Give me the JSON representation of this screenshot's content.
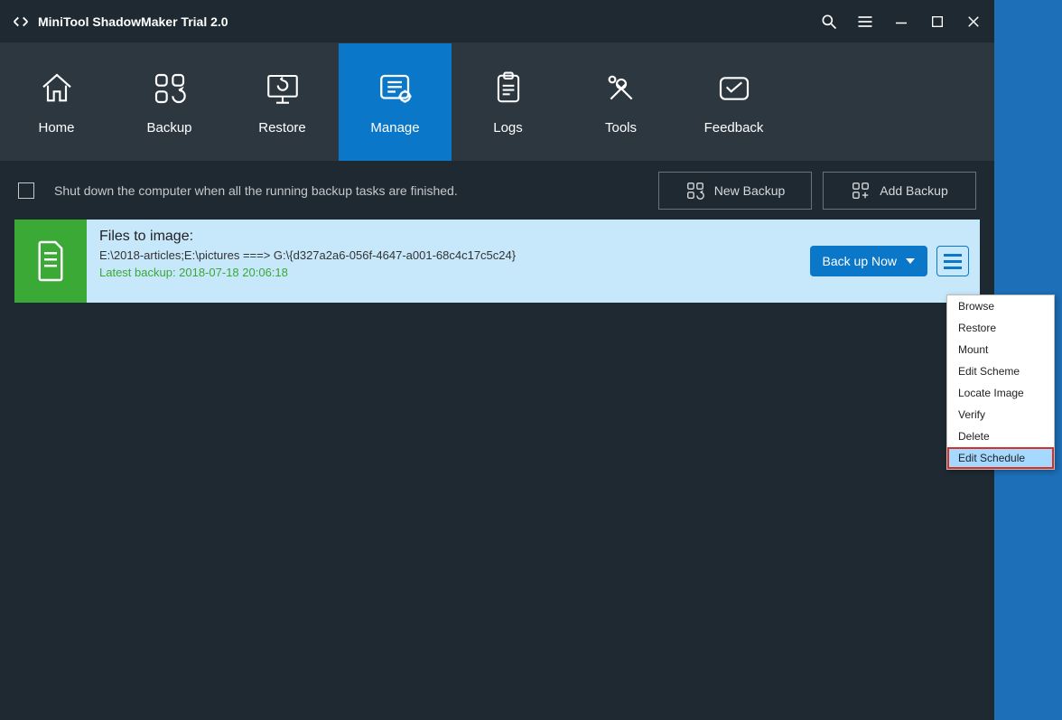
{
  "titlebar": {
    "title": "MiniTool ShadowMaker Trial 2.0"
  },
  "nav": {
    "items": [
      {
        "label": "Home"
      },
      {
        "label": "Backup"
      },
      {
        "label": "Restore"
      },
      {
        "label": "Manage"
      },
      {
        "label": "Logs"
      },
      {
        "label": "Tools"
      },
      {
        "label": "Feedback"
      }
    ]
  },
  "toolbar": {
    "shutdown_label": "Shut down the computer when all the running backup tasks are finished.",
    "new_backup": "New Backup",
    "add_backup": "Add Backup"
  },
  "task": {
    "title": "Files to image:",
    "path": "E:\\2018-articles;E:\\pictures ===> G:\\{d327a2a6-056f-4647-a001-68c4c17c5c24}",
    "latest_label": "Latest backup: 2018-07-18 20:06:18",
    "action": "Back up Now"
  },
  "menu": {
    "items": [
      "Browse",
      "Restore",
      "Mount",
      "Edit Scheme",
      "Locate Image",
      "Verify",
      "Delete",
      "Edit Schedule"
    ]
  }
}
